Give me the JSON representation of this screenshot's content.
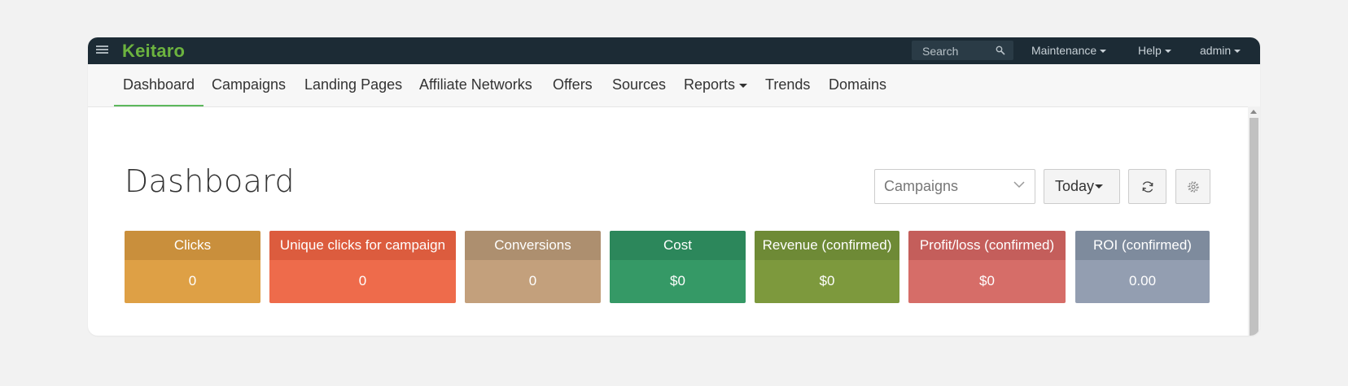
{
  "app": {
    "logo": "Keitaro"
  },
  "topbar": {
    "search_placeholder": "Search",
    "menus": [
      "Maintenance",
      "Help",
      "admin"
    ]
  },
  "nav": {
    "items": [
      "Dashboard",
      "Campaigns",
      "Landing Pages",
      "Affiliate Networks",
      "Offers",
      "Sources",
      "Reports",
      "Trends",
      "Domains"
    ],
    "active": "Dashboard"
  },
  "page": {
    "title": "Dashboard"
  },
  "controls": {
    "entity_select": "Campaigns",
    "date_range": "Today"
  },
  "cards": [
    {
      "label": "Clicks",
      "value": "0",
      "head_color": "#c98f3c",
      "body_color": "#dea045"
    },
    {
      "label": "Unique clicks for campaign",
      "value": "0",
      "head_color": "#dc5c3e",
      "body_color": "#ee6b4b"
    },
    {
      "label": "Conversions",
      "value": "0",
      "head_color": "#ad8f6f",
      "body_color": "#c3a07c"
    },
    {
      "label": "Cost",
      "value": "$0",
      "head_color": "#2c875b",
      "body_color": "#359966"
    },
    {
      "label": "Revenue (confirmed)",
      "value": "$0",
      "head_color": "#6e8a36",
      "body_color": "#7d993d"
    },
    {
      "label": "Profit/loss (confirmed)",
      "value": "$0",
      "head_color": "#c45e5b",
      "body_color": "#d66d68"
    },
    {
      "label": "ROI (confirmed)",
      "value": "0.00",
      "head_color": "#7e8b9d",
      "body_color": "#939eb1"
    }
  ],
  "colors": {
    "topbar": "#1c2b35",
    "logo": "#6cb33f",
    "active_tab": "#5cb85c"
  }
}
